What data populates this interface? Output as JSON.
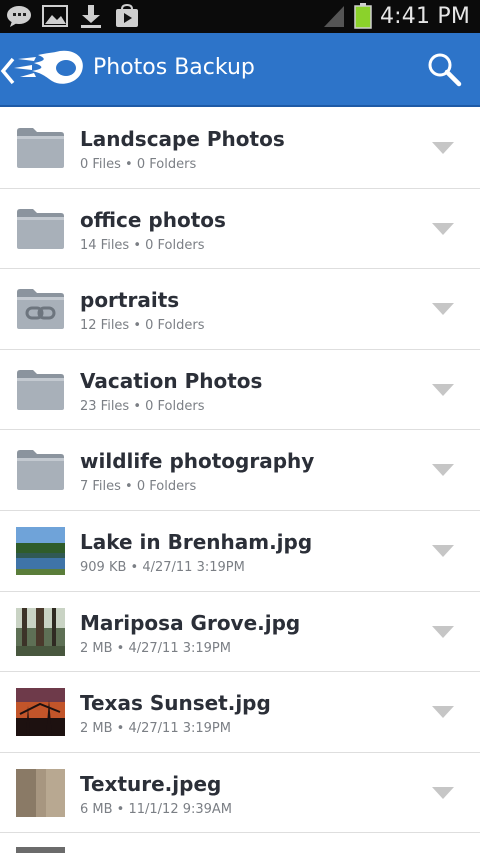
{
  "status_bar": {
    "time": "4:41 PM",
    "icons": [
      "chat-notification-icon",
      "image-notification-icon",
      "download-icon",
      "play-store-icon",
      "signal-icon",
      "battery-icon"
    ],
    "battery_color": "#8bd22b"
  },
  "app_bar": {
    "title": "Photos Backup",
    "background": "#2d74c9",
    "logo": "mediafire-logo",
    "search_icon": "search-icon"
  },
  "items": [
    {
      "type": "folder",
      "name": "Landscape Photos",
      "meta": "0 Files • 0 Folders"
    },
    {
      "type": "folder",
      "name": "office photos",
      "meta": "14 Files • 0 Folders"
    },
    {
      "type": "shared-folder",
      "name": "portraits",
      "meta": "12 Files • 0 Folders"
    },
    {
      "type": "folder",
      "name": "Vacation Photos",
      "meta": "23 Files • 0 Folders"
    },
    {
      "type": "folder",
      "name": "wildlife photography",
      "meta": "7 Files • 0 Folders"
    },
    {
      "type": "image",
      "thumb": "lake",
      "name": "Lake in Brenham.jpg",
      "meta": "909 KB • 4/27/11 3:19PM"
    },
    {
      "type": "image",
      "thumb": "forest",
      "name": "Mariposa Grove.jpg",
      "meta": "2 MB • 4/27/11 3:19PM"
    },
    {
      "type": "image",
      "thumb": "sunset",
      "name": "Texas Sunset.jpg",
      "meta": "2 MB • 4/27/11 3:19PM"
    },
    {
      "type": "image",
      "thumb": "texture",
      "name": "Texture.jpeg",
      "meta": "6 MB • 11/1/12 9:39AM"
    }
  ]
}
